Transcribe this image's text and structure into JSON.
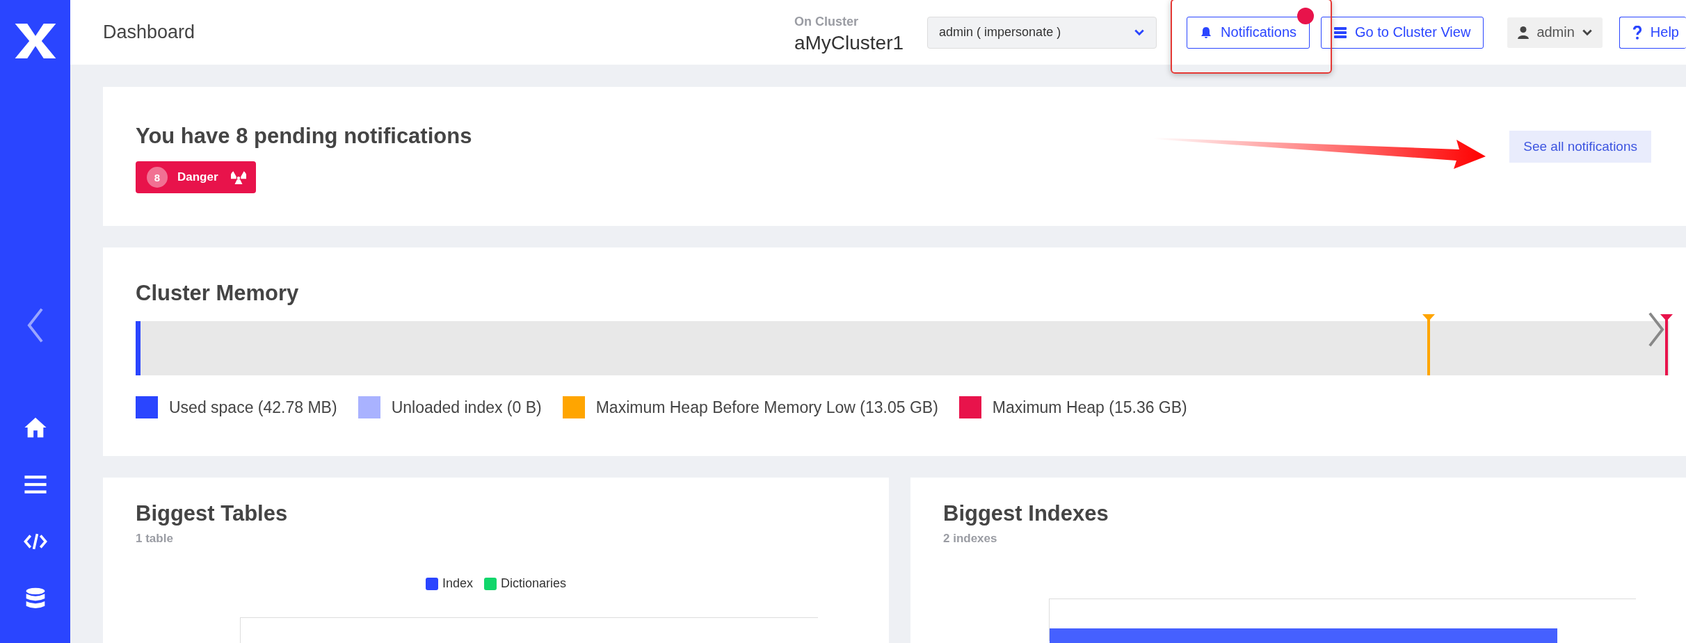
{
  "header": {
    "title": "Dashboard",
    "cluster_label": "On Cluster",
    "cluster_name": "aMyCluster1",
    "user_select": {
      "value": "admin ( impersonate )"
    },
    "notifications_button": {
      "label": "Notifications",
      "unread": true,
      "highlighted": true
    },
    "cluster_view_button": {
      "label": "Go to Cluster View"
    },
    "user_menu": {
      "label": "admin"
    },
    "help_button": {
      "label": "Help"
    }
  },
  "notifications": {
    "title": "You have 8 pending notifications",
    "badges": [
      {
        "count": "8",
        "label": "Danger",
        "color": "#e8134b"
      }
    ],
    "see_all": "See all notifications",
    "pointer_arrow": true
  },
  "cluster_memory": {
    "title": "Cluster Memory",
    "used": {
      "level": 0.003
    },
    "markers": [
      {
        "color": "#ffa500",
        "level": 0.843
      },
      {
        "color": "#e8134b",
        "level": 0.998
      }
    ],
    "legend": [
      {
        "label": "Used space (42.78 MB)",
        "color": "#2a45ff"
      },
      {
        "label": "Unloaded index (0 B)",
        "color": "#a9b2ff"
      },
      {
        "label": "Maximum Heap Before Memory Low (13.05 GB)",
        "color": "#ffa500"
      },
      {
        "label": "Maximum Heap (15.36 GB)",
        "color": "#e8134b"
      }
    ]
  },
  "biggest_tables": {
    "title": "Biggest Tables",
    "subtitle": "1 table",
    "legend": [
      {
        "label": "Index",
        "color": "#2a45ff"
      },
      {
        "label": "Dictionaries",
        "color": "#11d66b"
      }
    ]
  },
  "biggest_indexes": {
    "title": "Biggest Indexes",
    "subtitle": "2 indexes"
  }
}
